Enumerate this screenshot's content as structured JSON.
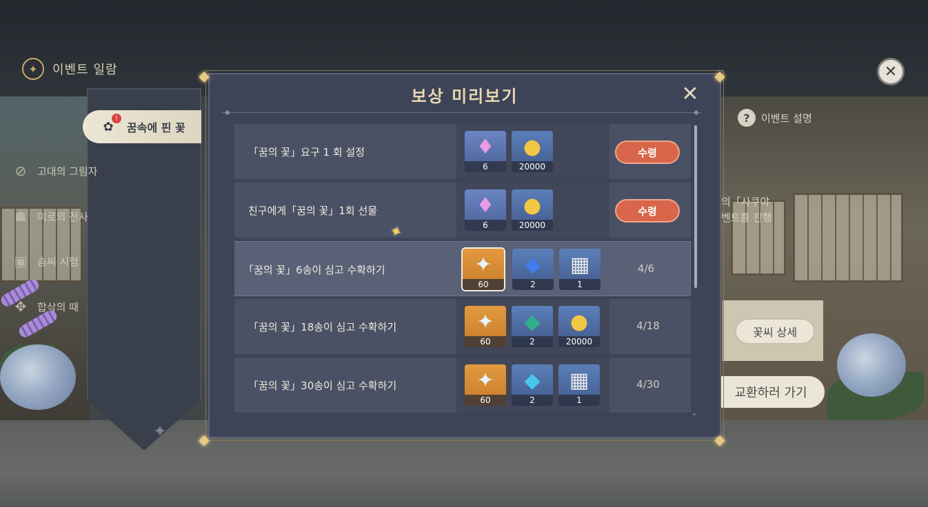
{
  "header": {
    "title": "이벤트 일람",
    "close_glyph": "✕"
  },
  "sidebar": {
    "items": [
      {
        "label": "꿈속에 핀 꽃",
        "icon": "potted-flower-icon",
        "active": true,
        "badge": "!"
      },
      {
        "label": "고대의 그림자",
        "icon": "ancient-shield-icon",
        "active": false
      },
      {
        "label": "미로의 전사",
        "icon": "warrior-mask-icon",
        "active": false
      },
      {
        "label": "솜씨 시험",
        "icon": "cards-icon",
        "active": false
      },
      {
        "label": "합삭의 때",
        "icon": "lantern-icon",
        "active": false
      }
    ]
  },
  "background_panel": {
    "help_label": "이벤트 설명",
    "desc_line1": "의「사쿠야",
    "desc_line2": "벤트를 진행",
    "seed_button": "꽃씨 상세",
    "exchange_button": "교환하러 가기"
  },
  "modal": {
    "title": "보상 미리보기",
    "close_glyph": "✕",
    "rows": [
      {
        "name": "「꿈의 꽃」요구 1 회 설정",
        "rewards": [
          {
            "icon": "primogem-crystal-icon",
            "count": "6",
            "bg": "purple"
          },
          {
            "icon": "mora-coin-icon",
            "count": "20000",
            "bg": "blue"
          }
        ],
        "action": "수령",
        "progress": ""
      },
      {
        "name": "친구에게「꿈의 꽃」1회 선물",
        "rewards": [
          {
            "icon": "primogem-crystal-icon",
            "count": "6",
            "bg": "purple"
          },
          {
            "icon": "mora-coin-icon",
            "count": "20000",
            "bg": "blue"
          }
        ],
        "action": "수령",
        "progress": ""
      },
      {
        "name": "「꿈의 꽃」6송이 심고 수확하기",
        "rewards": [
          {
            "icon": "intertwined-star-icon",
            "count": "60",
            "bg": "gold"
          },
          {
            "icon": "blue-crystal-icon",
            "count": "2",
            "bg": "blue"
          },
          {
            "icon": "gift-box-icon",
            "count": "1",
            "bg": "blue"
          }
        ],
        "action": "",
        "progress": "4/6"
      },
      {
        "name": "「꿈의 꽃」18송이 심고 수확하기",
        "rewards": [
          {
            "icon": "intertwined-star-icon",
            "count": "60",
            "bg": "gold"
          },
          {
            "icon": "green-crystal-icon",
            "count": "2",
            "bg": "blue"
          },
          {
            "icon": "mora-coin-icon",
            "count": "20000",
            "bg": "blue"
          }
        ],
        "action": "",
        "progress": "4/18"
      },
      {
        "name": "「꿈의 꽃」30송이 심고 수확하기",
        "rewards": [
          {
            "icon": "intertwined-star-icon",
            "count": "60",
            "bg": "gold"
          },
          {
            "icon": "cyan-crystal-icon",
            "count": "2",
            "bg": "blue"
          },
          {
            "icon": "gift-box-icon",
            "count": "1",
            "bg": "blue"
          }
        ],
        "action": "",
        "progress": "4/30"
      }
    ]
  },
  "colors": {
    "modal_bg": "#3d4457",
    "row_bg": "#4a5164",
    "claim_button": "#d9664a",
    "title_text": "#e8d7b0"
  }
}
